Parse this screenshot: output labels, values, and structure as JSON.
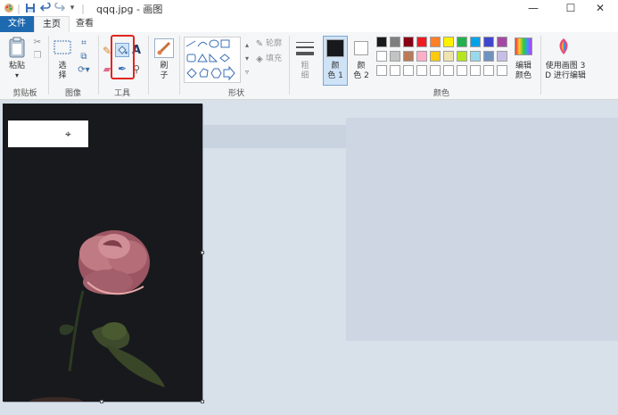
{
  "window": {
    "title": "qqq.jpg - 画图",
    "save_icon": "save-icon",
    "undo_icon": "undo-icon",
    "redo_icon": "redo-icon",
    "minimize_symbol": "—",
    "maximize_symbol": "☐",
    "close_symbol": "✕"
  },
  "tabs": {
    "file": "文件",
    "home": "主页",
    "view": "查看"
  },
  "groups": {
    "clipboard": "剪贴板",
    "image": "图像",
    "tools": "工具",
    "shapes": "形状",
    "colors": "颜色"
  },
  "ribbon": {
    "paste": "粘贴",
    "select": "选",
    "select2": "择",
    "brushes": "刷",
    "brushes2": "子",
    "outline": "轮廓",
    "fill": "填充",
    "size": "粗",
    "size2": "细",
    "color1": "颜",
    "color1b": "色 1",
    "color2": "颜",
    "color2b": "色 2",
    "edit_colors": "编辑",
    "edit_colors2": "颜色",
    "paint3d": "使用画图 3",
    "paint3d2": "D 进行编辑"
  },
  "colors": {
    "accent": "#1e6ab1",
    "highlight_box": "#e0261f",
    "workspace": "#d8e0ea",
    "color1": "#18191c",
    "color2": "#ffffff",
    "palette_row1": [
      "#1a1a1a",
      "#7f7f7f",
      "#880015",
      "#ed1c24",
      "#ff7f27",
      "#fff200",
      "#22b14c",
      "#00a2e8",
      "#3f48cc",
      "#a349a4"
    ],
    "palette_row2": [
      "#ffffff",
      "#c3c3c3",
      "#b97a57",
      "#ffaec9",
      "#ffc90e",
      "#efe4b0",
      "#b5e61d",
      "#99d9ea",
      "#7092be",
      "#c8bfe7"
    ],
    "palette_row3": [
      "#ffffff",
      "#ffffff",
      "#ffffff",
      "#ffffff",
      "#ffffff",
      "#ffffff",
      "#ffffff",
      "#ffffff",
      "#ffffff",
      "#ffffff"
    ]
  }
}
